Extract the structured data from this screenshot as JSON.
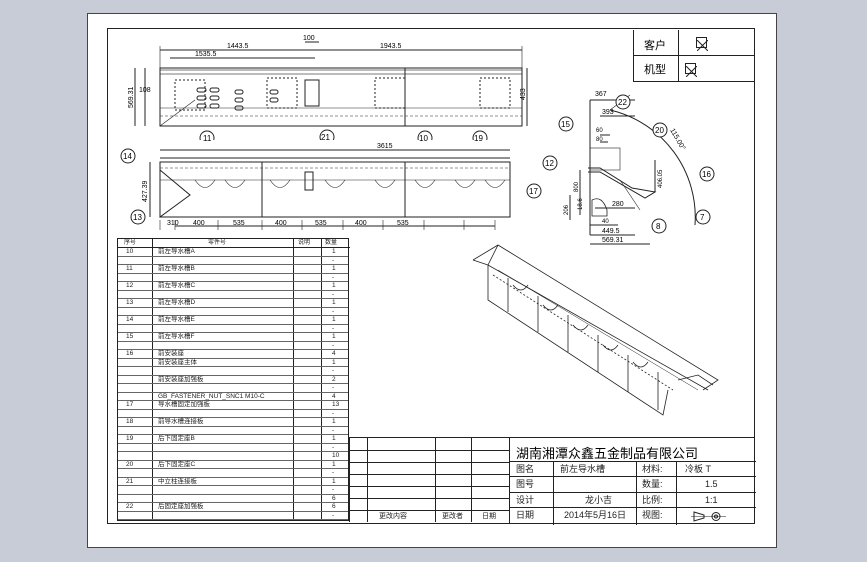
{
  "header": {
    "customer_label": "客户",
    "model_label": "机型"
  },
  "dims": {
    "top": [
      "1443.5",
      "1535.5",
      "100",
      "1943.5",
      "108",
      "569.31",
      "433"
    ],
    "front": [
      "3615",
      "427.39",
      "310",
      "400",
      "535",
      "400",
      "535",
      "400",
      "535"
    ],
    "side": [
      "367",
      "393",
      "60",
      "80",
      "22",
      "115.00°",
      "17",
      "406.05",
      "800",
      "206",
      "18.6",
      "280",
      "40",
      "449.5",
      "569.31"
    ]
  },
  "balloons": {
    "top": [
      "11",
      "21",
      "10",
      "19"
    ],
    "front": [
      "14",
      "13"
    ],
    "side": [
      "15",
      "22",
      "20",
      "12",
      "16",
      "17",
      "8",
      "7"
    ]
  },
  "bom": {
    "headers": [
      "序号",
      "零件号",
      "说明",
      "数量"
    ],
    "rows": [
      {
        "no": "10",
        "name": "前左导水槽A",
        "qty": "1"
      },
      {
        "no": "",
        "name": "",
        "qty": "-"
      },
      {
        "no": "11",
        "name": "前左导水槽B",
        "qty": "1"
      },
      {
        "no": "",
        "name": "",
        "qty": "-"
      },
      {
        "no": "12",
        "name": "前左导水槽C",
        "qty": "1"
      },
      {
        "no": "",
        "name": "",
        "qty": "-"
      },
      {
        "no": "13",
        "name": "前左导水槽D",
        "qty": "1"
      },
      {
        "no": "",
        "name": "",
        "qty": "-"
      },
      {
        "no": "14",
        "name": "前左导水槽E",
        "qty": "1"
      },
      {
        "no": "",
        "name": "",
        "qty": "-"
      },
      {
        "no": "15",
        "name": "前左导水槽F",
        "qty": "1"
      },
      {
        "no": "",
        "name": "",
        "qty": "-"
      },
      {
        "no": "16",
        "name": "前安装座",
        "qty": "4"
      },
      {
        "no": "",
        "name": "前安装座主体",
        "qty": "1"
      },
      {
        "no": "",
        "name": "",
        "qty": "-"
      },
      {
        "no": "",
        "name": "前安装座加强板",
        "qty": "2"
      },
      {
        "no": "",
        "name": "",
        "qty": "-"
      },
      {
        "no": "",
        "name": "GB_FASTENER_NUT_SNC1 M10-C",
        "qty": "4"
      },
      {
        "no": "17",
        "name": "导水槽固定加强板",
        "qty": "13"
      },
      {
        "no": "",
        "name": "",
        "qty": "-"
      },
      {
        "no": "18",
        "name": "前导水槽连接板",
        "qty": "1"
      },
      {
        "no": "",
        "name": "",
        "qty": "-"
      },
      {
        "no": "19",
        "name": "后下固定座B",
        "qty": "1"
      },
      {
        "no": "",
        "name": "",
        "qty": "-"
      },
      {
        "no": "",
        "name": "",
        "qty": "10"
      },
      {
        "no": "20",
        "name": "后下固定座C",
        "qty": "1"
      },
      {
        "no": "",
        "name": "",
        "qty": "-"
      },
      {
        "no": "21",
        "name": "中立柱连接板",
        "qty": "1"
      },
      {
        "no": "",
        "name": "",
        "qty": "-"
      },
      {
        "no": "",
        "name": "",
        "qty": "6"
      },
      {
        "no": "22",
        "name": "后固定座加强板",
        "qty": "6"
      },
      {
        "no": "",
        "name": "",
        "qty": "-"
      }
    ]
  },
  "title_block": {
    "company": "湖南湘潭众鑫五金制品有限公司",
    "name_label": "图名",
    "name_value": "前左导水槽",
    "material_label": "材料:",
    "material_value": "冷板 T",
    "drawing_no_label": "图号",
    "qty_label": "数量:",
    "qty_value": "1.5",
    "design_label": "设计",
    "design_value": "龙小吉",
    "scale_label": "比例:",
    "scale_value": "1:1",
    "date_label": "日期",
    "date_value": "2014年5月16日",
    "view_label": "视图:",
    "rev_headers": [
      "更改内容",
      "更改者",
      "日期"
    ]
  }
}
